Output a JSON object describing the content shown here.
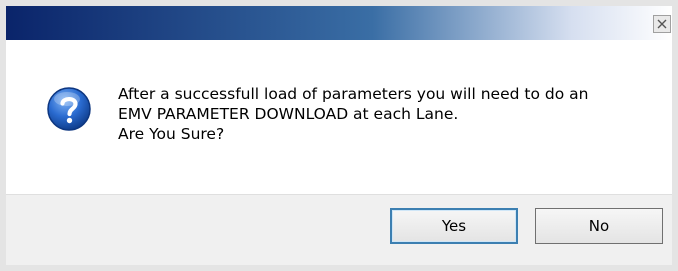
{
  "dialog": {
    "close_symbol": "×",
    "icon": "question-icon",
    "message_lines": [
      "After a successfull load of parameters you will need to do an",
      "EMV PARAMETER DOWNLOAD at each Lane.",
      "Are You Sure?"
    ],
    "buttons": {
      "yes_label": "Yes",
      "no_label": "No"
    }
  },
  "colors": {
    "titlebar_start": "#0a246a",
    "icon_blue": "#2a6bd0",
    "footer_bg": "#f0f0f0",
    "default_button_border": "#3c7fb1"
  }
}
